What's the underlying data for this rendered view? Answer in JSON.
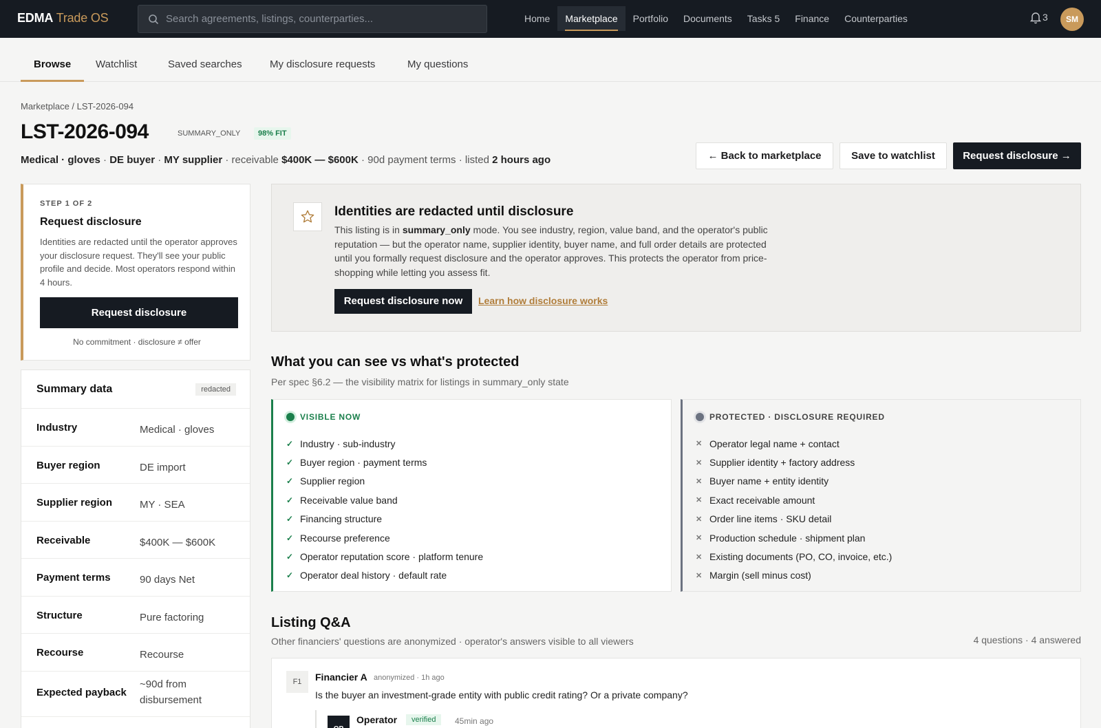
{
  "brand": {
    "name": "EDMA",
    "suffix": "Trade OS"
  },
  "search": {
    "placeholder": "Search agreements, listings, counterparties..."
  },
  "nav": {
    "items": [
      "Home",
      "Marketplace",
      "Portfolio",
      "Documents",
      "Tasks 5",
      "Finance",
      "Counterparties"
    ],
    "active": "Marketplace"
  },
  "notifications": {
    "count": "3"
  },
  "user": {
    "initials": "SM"
  },
  "subtabs": [
    "Browse",
    "Watchlist",
    "Saved searches",
    "My disclosure requests",
    "My questions"
  ],
  "breadcrumb": {
    "root": "Marketplace",
    "current": "LST-2026-094"
  },
  "listing": {
    "id": "LST-2026-094",
    "mode": "SUMMARY_ONLY",
    "fit": "98% FIT",
    "meta": {
      "industry": "Medical · gloves",
      "buyer": "DE buyer",
      "supplier": "MY supplier",
      "receivable_label": "receivable",
      "receivable": "$400K — $600K",
      "terms": "90d payment terms",
      "listed_label": "listed",
      "listed": "2 hours ago"
    }
  },
  "actions": {
    "back": "← Back to marketplace",
    "watch": "Save to watchlist",
    "request": "Request disclosure →"
  },
  "step": {
    "label": "STEP 1 OF 2",
    "title": "Request disclosure",
    "text": "Identities are redacted until the operator approves your disclosure request. They'll see your public profile and decide. Most operators respond within 4 hours.",
    "button": "Request disclosure",
    "note": "No commitment · disclosure ≠ offer"
  },
  "summary": {
    "title": "Summary data",
    "tag": "redacted",
    "rows": [
      {
        "k": "Industry",
        "v": "Medical · gloves"
      },
      {
        "k": "Buyer region",
        "v": "DE import"
      },
      {
        "k": "Supplier region",
        "v": "MY · SEA"
      },
      {
        "k": "Receivable",
        "v": "$400K — $600K"
      },
      {
        "k": "Payment terms",
        "v": "90 days Net"
      },
      {
        "k": "Structure",
        "v": "Pure factoring"
      },
      {
        "k": "Recourse",
        "v": "Recourse"
      },
      {
        "k": "Expected payback",
        "v": "~90d from disbursement"
      }
    ]
  },
  "notice": {
    "title": "Identities are redacted until disclosure",
    "text_before": "This listing is in ",
    "text_mode": "summary_only",
    "text_after": " mode. You see industry, region, value band, and the operator's public reputation — but the operator name, supplier identity, buyer name, and full order details are protected until you formally request disclosure and the operator approves. This protects the operator from price-shopping while letting you assess fit.",
    "button": "Request disclosure now",
    "link": "Learn how disclosure works"
  },
  "visibility": {
    "title": "What you can see vs what's protected",
    "subtitle": "Per spec §6.2 — the visibility matrix for listings in summary_only state",
    "visible": {
      "head": "VISIBLE NOW",
      "items": [
        "Industry · sub-industry",
        "Buyer region · payment terms",
        "Supplier region",
        "Receivable value band",
        "Financing structure",
        "Recourse preference",
        "Operator reputation score · platform tenure",
        "Operator deal history · default rate"
      ]
    },
    "protected": {
      "head": "PROTECTED · DISCLOSURE REQUIRED",
      "items": [
        "Operator legal name + contact",
        "Supplier identity + factory address",
        "Buyer name + entity identity",
        "Exact receivable amount",
        "Order line items · SKU detail",
        "Production schedule · shipment plan",
        "Existing documents (PO, CO, invoice, etc.)",
        "Margin (sell minus cost)"
      ]
    }
  },
  "qa": {
    "title": "Listing Q&A",
    "subtitle": "Other financiers' questions are anonymized · operator's answers visible to all viewers",
    "count": "4 questions · 4 answered",
    "question": {
      "avatar": "F1",
      "name": "Financier A",
      "meta": "anonymized · 1h ago",
      "text": "Is the buyer an investment-grade entity with public credit rating? Or a private company?"
    },
    "answer": {
      "avatar": "OP",
      "name": "Operator",
      "badge": "verified",
      "time": "45min ago"
    }
  },
  "colors": {
    "accent": "#c99a5b",
    "dark": "#161b22",
    "visible": "#1a7f4b",
    "protected": "#6b7280"
  }
}
